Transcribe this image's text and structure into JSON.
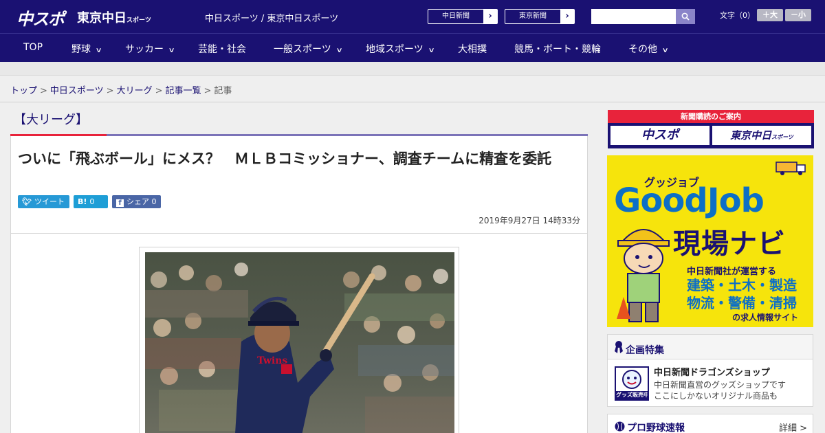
{
  "header": {
    "logo_chuspo": "中スポ",
    "logo_tokyo": "東京中日",
    "logo_tokyo_small": "スポーツ",
    "site_name": "中日スポーツ / 東京中日スポーツ",
    "buttons": [
      {
        "label": "中日新聞"
      },
      {
        "label": "東京新聞"
      }
    ],
    "font_size_label": "文字（0）",
    "font_larger": "＋大",
    "font_smaller": "－小"
  },
  "nav": {
    "items": [
      {
        "label": "TOP"
      },
      {
        "label": "野球"
      },
      {
        "label": "サッカー"
      },
      {
        "label": "芸能・社会"
      },
      {
        "label": "一般スポーツ"
      },
      {
        "label": "地域スポーツ"
      },
      {
        "label": "大相撲"
      },
      {
        "label": "競馬・ボート・競輪"
      },
      {
        "label": "その他"
      }
    ]
  },
  "breadcrumb": {
    "items": [
      "トップ",
      "中日スポーツ",
      "大リーグ",
      "記事一覧"
    ],
    "current": "記事",
    "separator": ">"
  },
  "section": {
    "title": "【大リーグ】"
  },
  "article": {
    "headline": "ついに「飛ぶボール」にメス？　ＭＬＢコミッショナー、調査チームに精査を委託",
    "share": {
      "tweet": "ツイート",
      "hatena_icon": "B!",
      "hatena_count": "0",
      "facebook": "シェア",
      "facebook_count": "0"
    },
    "date": "2019年9月27日 14時33分"
  },
  "sidebar": {
    "subscription": {
      "heading": "新聞購読のご案内",
      "left": "中スポ",
      "right": "東京中日",
      "right_small": "スポーツ"
    },
    "ad": {
      "top_text": "グッジョブ",
      "brand": "GoodJob",
      "subtitle": "現場ナビ",
      "operator": "中日新聞社が運営する",
      "jobs_line1": "建築・土木・製造",
      "jobs_line2": "物流・警備・清掃",
      "footer": "の求人情報サイト"
    },
    "feature": {
      "heading": "企画特集",
      "title": "中日新聞ドラゴンズショップ",
      "desc_line1": "中日新聞直営のグッズショップです",
      "desc_line2": "ここにしかないオリジナル商品も",
      "thumb_text": "グッズ販売中"
    },
    "pro_baseball": {
      "title": "プロ野球速報",
      "more": "詳細 >"
    }
  },
  "colors": {
    "header_bg": "#1a1172",
    "accent_red": "#e8233b",
    "ad_yellow": "#f6e40c",
    "ad_blue": "#0d6fc6"
  }
}
